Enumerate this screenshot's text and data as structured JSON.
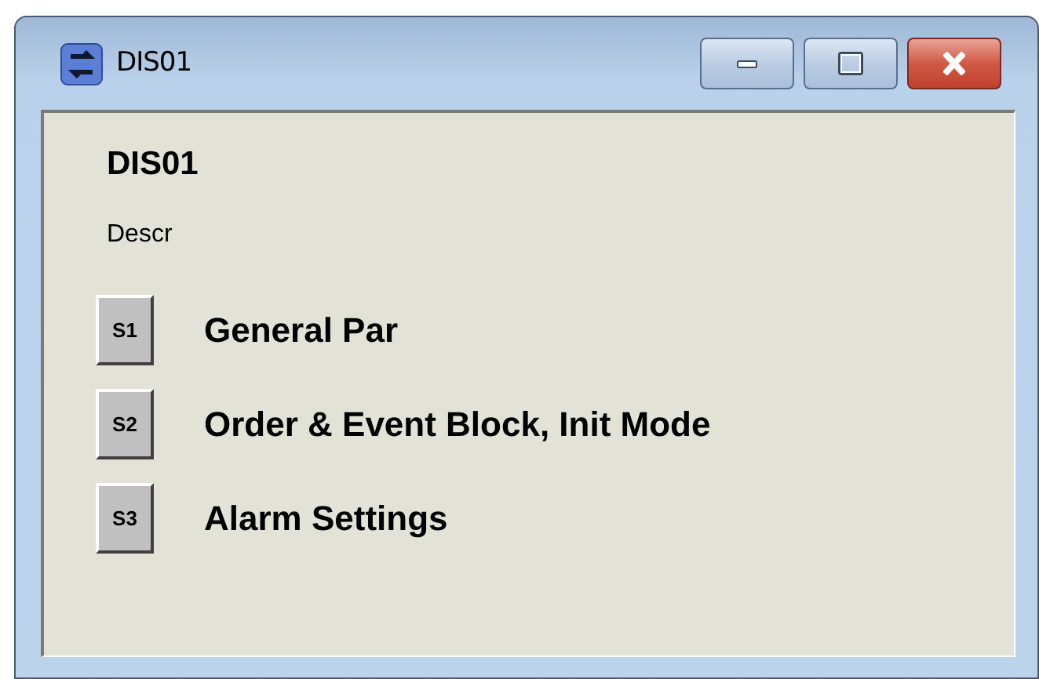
{
  "window": {
    "title": "DIS01",
    "buttons": [
      {
        "kind": "minimize"
      },
      {
        "kind": "maximize"
      },
      {
        "kind": "close"
      }
    ]
  },
  "heading": "DIS01",
  "description": "Descr",
  "sections": [
    {
      "button": "S1",
      "label": "General Par"
    },
    {
      "button": "S2",
      "label": "Order & Event Block, Init Mode"
    },
    {
      "button": "S3",
      "label": "Alarm Settings"
    }
  ]
}
